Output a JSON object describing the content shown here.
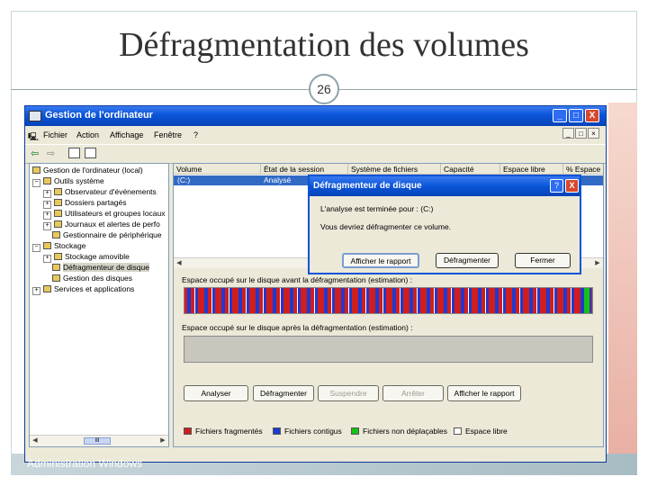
{
  "slide": {
    "title": "Défragmentation des volumes",
    "page_number": "26",
    "footer": "Administration Windows"
  },
  "window": {
    "title": "Gestion de l'ordinateur",
    "controls": {
      "minimize": "_",
      "maximize": "□",
      "close": "X"
    },
    "menu": [
      "Fichier",
      "Action",
      "Affichage",
      "Fenêtre",
      "?"
    ],
    "mdi_controls": {
      "minimize": "_",
      "restore": "□",
      "close": "×"
    }
  },
  "tree": {
    "items": [
      {
        "label": "Gestion de l'ordinateur (local)",
        "pm": ""
      },
      {
        "label": "Outils système",
        "pm": "−"
      },
      {
        "label": "Observateur d'événements",
        "pm": "+"
      },
      {
        "label": "Dossiers partagés",
        "pm": "+"
      },
      {
        "label": "Utilisateurs et groupes locaux",
        "pm": "+"
      },
      {
        "label": "Journaux et alertes de perfo",
        "pm": "+"
      },
      {
        "label": "Gestionnaire de périphérique",
        "pm": ""
      },
      {
        "label": "Stockage",
        "pm": "−"
      },
      {
        "label": "Stockage amovible",
        "pm": "+"
      },
      {
        "label": "Défragmenteur de disque",
        "pm": ""
      },
      {
        "label": "Gestion des disques",
        "pm": ""
      },
      {
        "label": "Services et applications",
        "pm": "+"
      }
    ],
    "scroll_thumb": "III"
  },
  "list": {
    "columns": [
      "Volume",
      "État de la session",
      "Système de fichiers",
      "Capacité",
      "Espace libre",
      "% Espace"
    ],
    "row": {
      "volume": "(C:)",
      "status": "Analysé"
    }
  },
  "defrag": {
    "before_label": "Espace occupé sur le disque avant la défragmentation (estimation) :",
    "after_label": "Espace occupé sur le disque après la défragmentation (estimation) :",
    "buttons": {
      "analyze": "Analyser",
      "defragment": "Défragmenter",
      "pause": "Suspendre",
      "stop": "Arrêter",
      "report": "Afficher le rapport"
    },
    "legend": [
      {
        "label": "Fichiers fragmentés",
        "color": "#d01d1d"
      },
      {
        "label": "Fichiers contigus",
        "color": "#1c3ad0"
      },
      {
        "label": "Fichiers non déplaçables",
        "color": "#16c016"
      },
      {
        "label": "Espace libre",
        "color": "#ffffff"
      }
    ]
  },
  "dialog": {
    "title": "Défragmenteur de disque",
    "line1": "L'analyse est terminée pour : (C:)",
    "line2": "Vous devriez défragmenter ce volume.",
    "buttons": {
      "report": "Afficher le rapport",
      "defragment": "Défragmenter",
      "close": "Fermer"
    },
    "help": "?",
    "close_x": "X"
  }
}
